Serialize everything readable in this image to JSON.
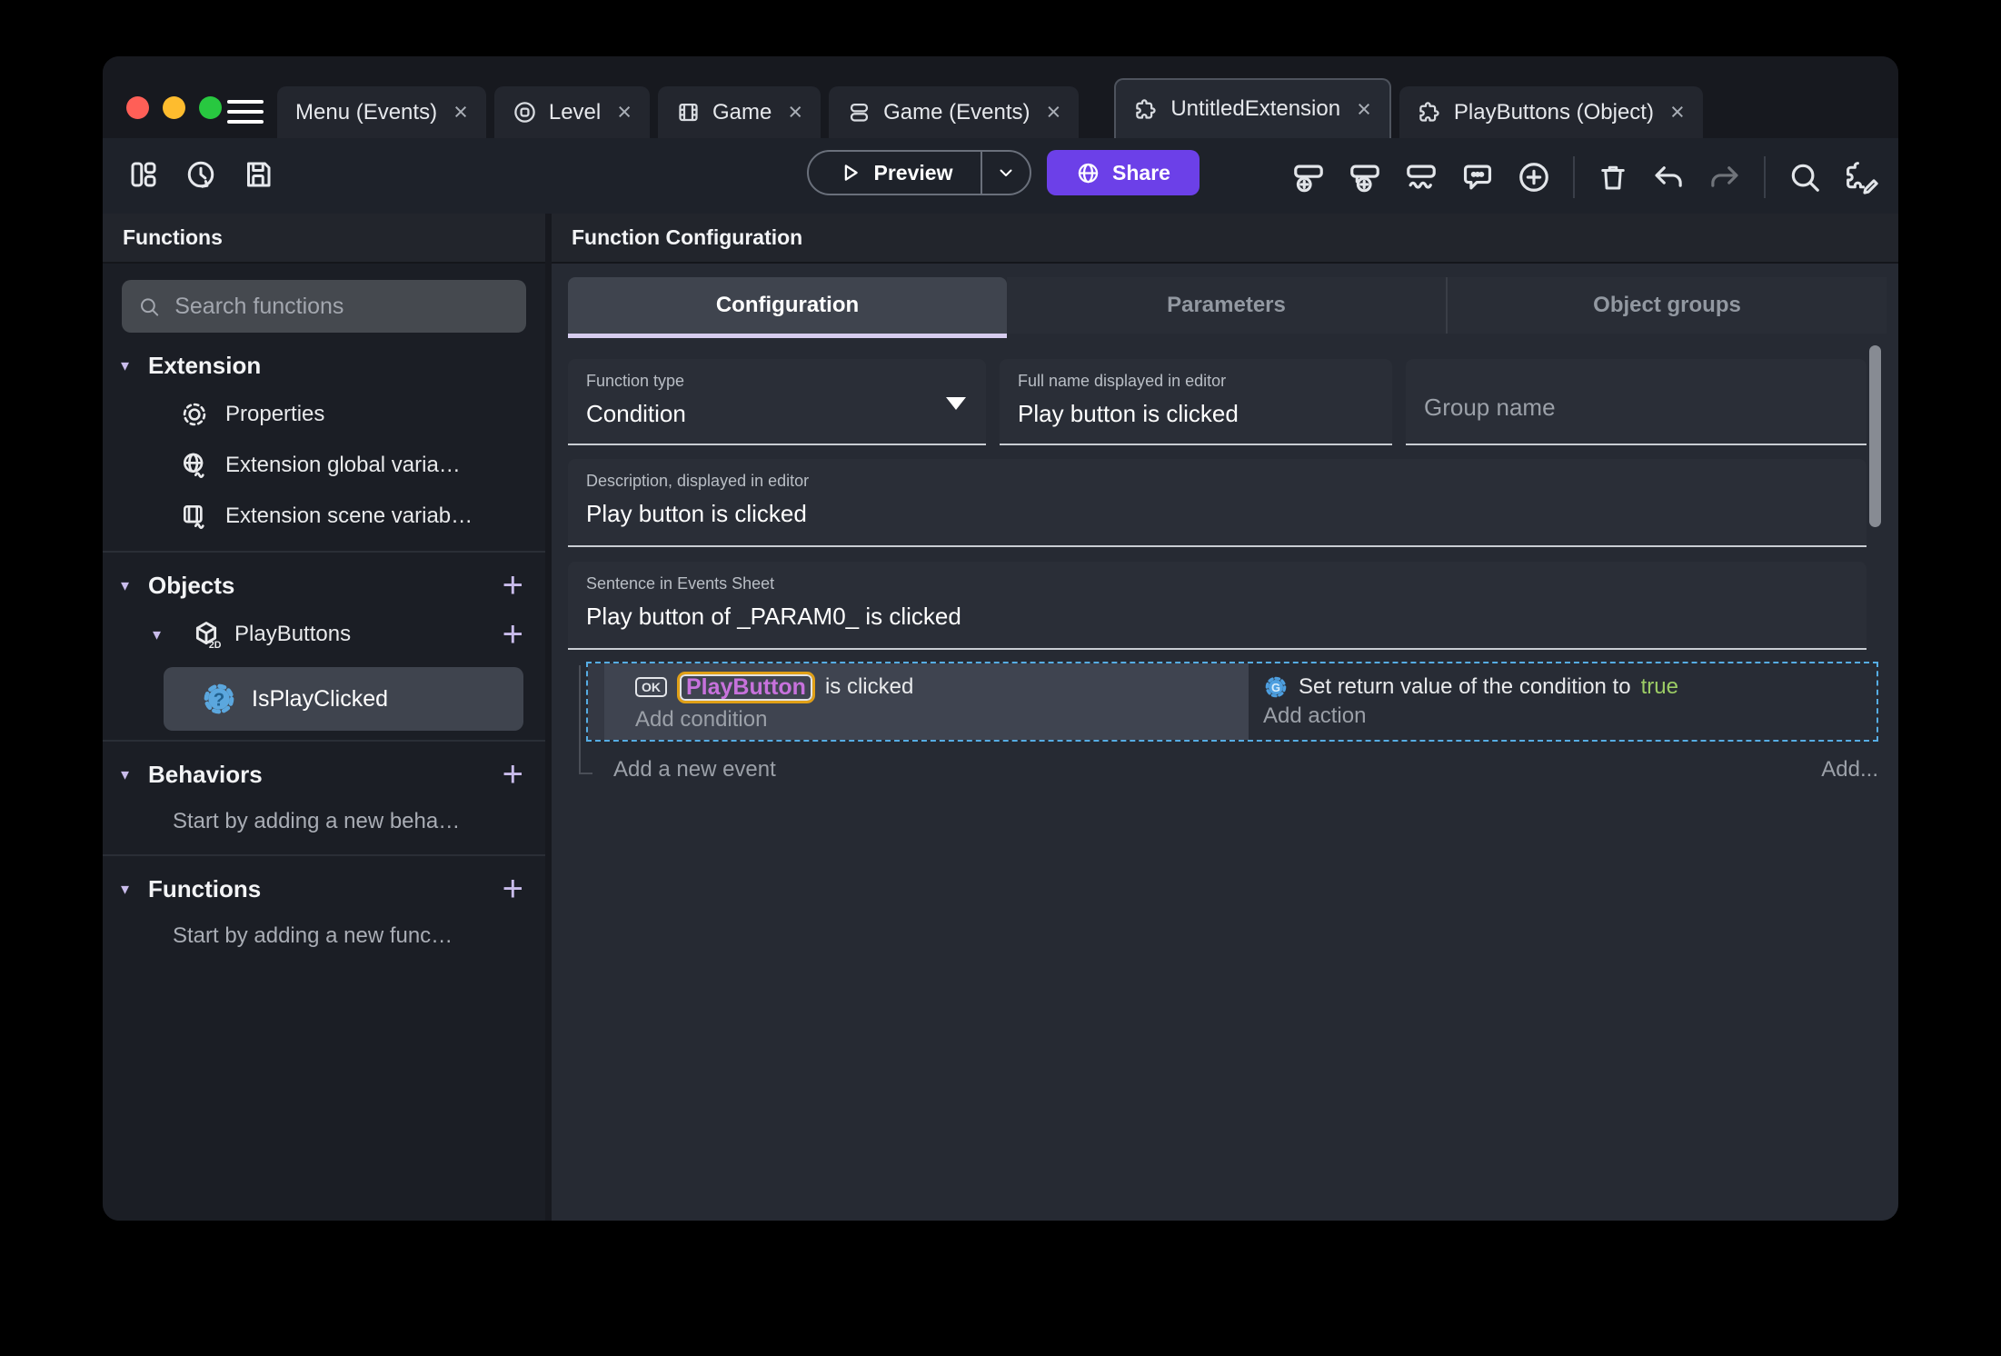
{
  "glyphs": {
    "close": "×",
    "section_arrow": "▾",
    "plus": "+"
  },
  "colors": {
    "accent_purple": "#6C40E8",
    "tab_underline": "#D7CDEF",
    "selection_blue": "#56ADE4",
    "object_highlight_border": "#E0A018",
    "object_text_purple": "#C772DC",
    "true_green": "#9CCC65",
    "action_icon_blue": "#4D9FE0",
    "function_icon_blue": "#5BA7DE",
    "traffic_red": "#FF5F57",
    "traffic_yellow": "#FEBC2E",
    "traffic_green": "#28C840"
  },
  "titlebar": {
    "tabs": [
      {
        "label": "Menu (Events)"
      },
      {
        "label": "Level"
      },
      {
        "label": "Game"
      },
      {
        "label": "Game (Events)"
      },
      {
        "label": "UntitledExtension"
      },
      {
        "label": "PlayButtons (Object)"
      }
    ]
  },
  "toolbar": {
    "preview_label": "Preview",
    "share_label": "Share"
  },
  "sidebar": {
    "title": "Functions",
    "search_placeholder": "Search functions",
    "extension_section": {
      "label": "Extension",
      "items": [
        "Properties",
        "Extension global varia…",
        "Extension scene variab…"
      ]
    },
    "objects_section": {
      "label": "Objects",
      "object_label": "PlayButtons",
      "selected_function": "IsPlayClicked"
    },
    "behaviors_section": {
      "label": "Behaviors",
      "empty_text": "Start by adding a new beha…"
    },
    "functions_section": {
      "label": "Functions",
      "empty_text": "Start by adding a new func…"
    }
  },
  "main": {
    "title": "Function Configuration",
    "tabs": [
      {
        "label": "Configuration"
      },
      {
        "label": "Parameters"
      },
      {
        "label": "Object groups"
      }
    ],
    "fields": {
      "function_type_label": "Function type",
      "function_type_value": "Condition",
      "full_name_label": "Full name displayed in editor",
      "full_name_value": "Play button is clicked",
      "group_name_placeholder": "Group name",
      "description_label": "Description, displayed in editor",
      "description_value": "Play button is clicked",
      "sentence_label": "Sentence in Events Sheet",
      "sentence_value": "Play button of _PARAM0_ is clicked"
    },
    "events": {
      "condition_icon_text": "OK",
      "condition_object": "PlayButton",
      "condition_text": "is clicked",
      "add_condition": "Add condition",
      "action_text": "Set return value of the condition to",
      "action_value": "true",
      "add_action": "Add action",
      "add_new_event": "Add a new event",
      "add_button": "Add..."
    }
  }
}
